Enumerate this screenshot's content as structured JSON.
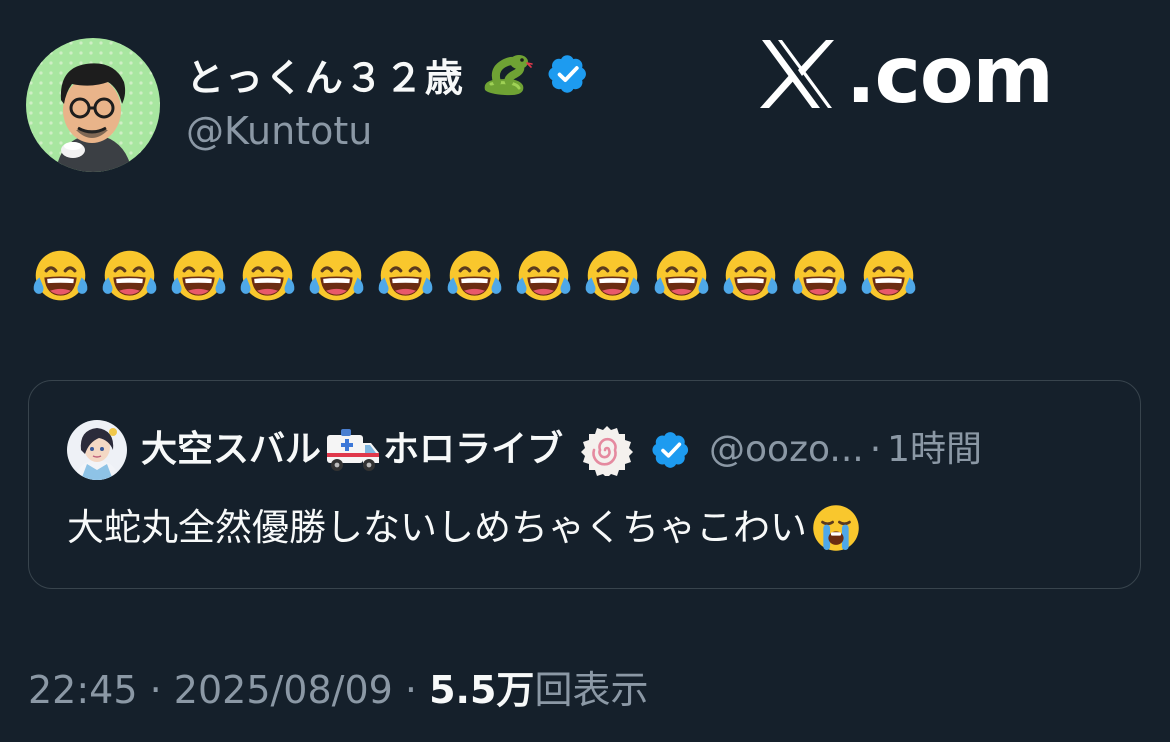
{
  "author": {
    "display_name": "とっくん３２歳",
    "handle": "@Kuntotu",
    "verified": true,
    "name_emoji": "snake-emoji"
  },
  "brand": {
    "label": ".com",
    "logo_icon": "x-logo-icon"
  },
  "post": {
    "emoji": "face-with-tears-of-joy",
    "emoji_count": 13
  },
  "quoted_post": {
    "display_name_part1": "大空スバル",
    "name_emoji": "ambulance-emoji",
    "display_name_part2": "ホロライブ",
    "badge_icon": "naruto-fishcake-icon",
    "verified": true,
    "handle": "@oozo...",
    "separator": "·",
    "time": "1時間",
    "text": "大蛇丸全然優勝しないしめちゃくちゃこわい",
    "text_emoji": "loudly-crying-face"
  },
  "footer": {
    "time": "22:45",
    "separator": "·",
    "date": "2025/08/09",
    "views_count": "5.5万",
    "views_label": "回表示"
  },
  "colors": {
    "background": "#15202b",
    "primary_text": "#f7f9f9",
    "secondary_text": "#8b98a5",
    "verified_blue": "#1d9bf0",
    "card_border": "#38444d"
  }
}
